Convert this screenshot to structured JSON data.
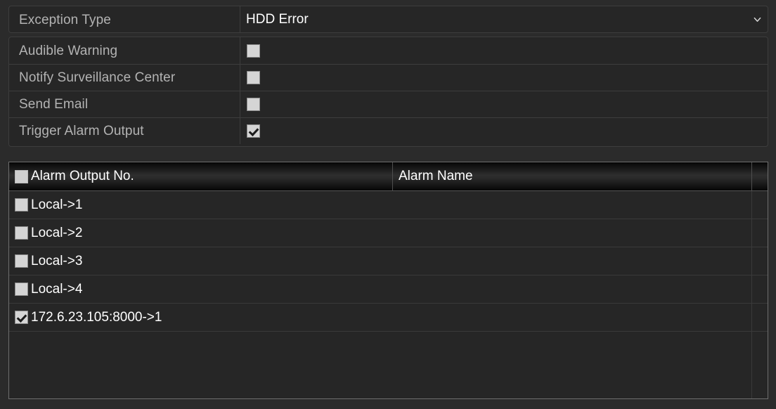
{
  "settings": {
    "exception": {
      "label": "Exception Type",
      "value": "HDD Error",
      "chevron_icon": "chevron-down-icon"
    },
    "triggers": [
      {
        "label": "Audible Warning",
        "checked": false
      },
      {
        "label": "Notify Surveillance Center",
        "checked": false
      },
      {
        "label": "Send Email",
        "checked": false
      },
      {
        "label": "Trigger Alarm Output",
        "checked": true
      }
    ]
  },
  "alarm_table": {
    "headers": {
      "select_all_checked": false,
      "col1": "Alarm Output No.",
      "col2": "Alarm Name",
      "col3": ""
    },
    "rows": [
      {
        "checked": false,
        "no": "Local->1",
        "name": ""
      },
      {
        "checked": false,
        "no": "Local->2",
        "name": ""
      },
      {
        "checked": false,
        "no": "Local->3",
        "name": ""
      },
      {
        "checked": false,
        "no": "Local->4",
        "name": ""
      },
      {
        "checked": true,
        "no": "172.6.23.105:8000->1",
        "name": ""
      }
    ]
  },
  "colors": {
    "background": "#2b2b2b",
    "panel": "#262626",
    "panel_border": "#3d3d3d",
    "table_border": "#6e6e6e",
    "label_text": "#b3b3b3",
    "value_text": "#ffffff",
    "checkbox_fill": "#d5d5d5"
  }
}
